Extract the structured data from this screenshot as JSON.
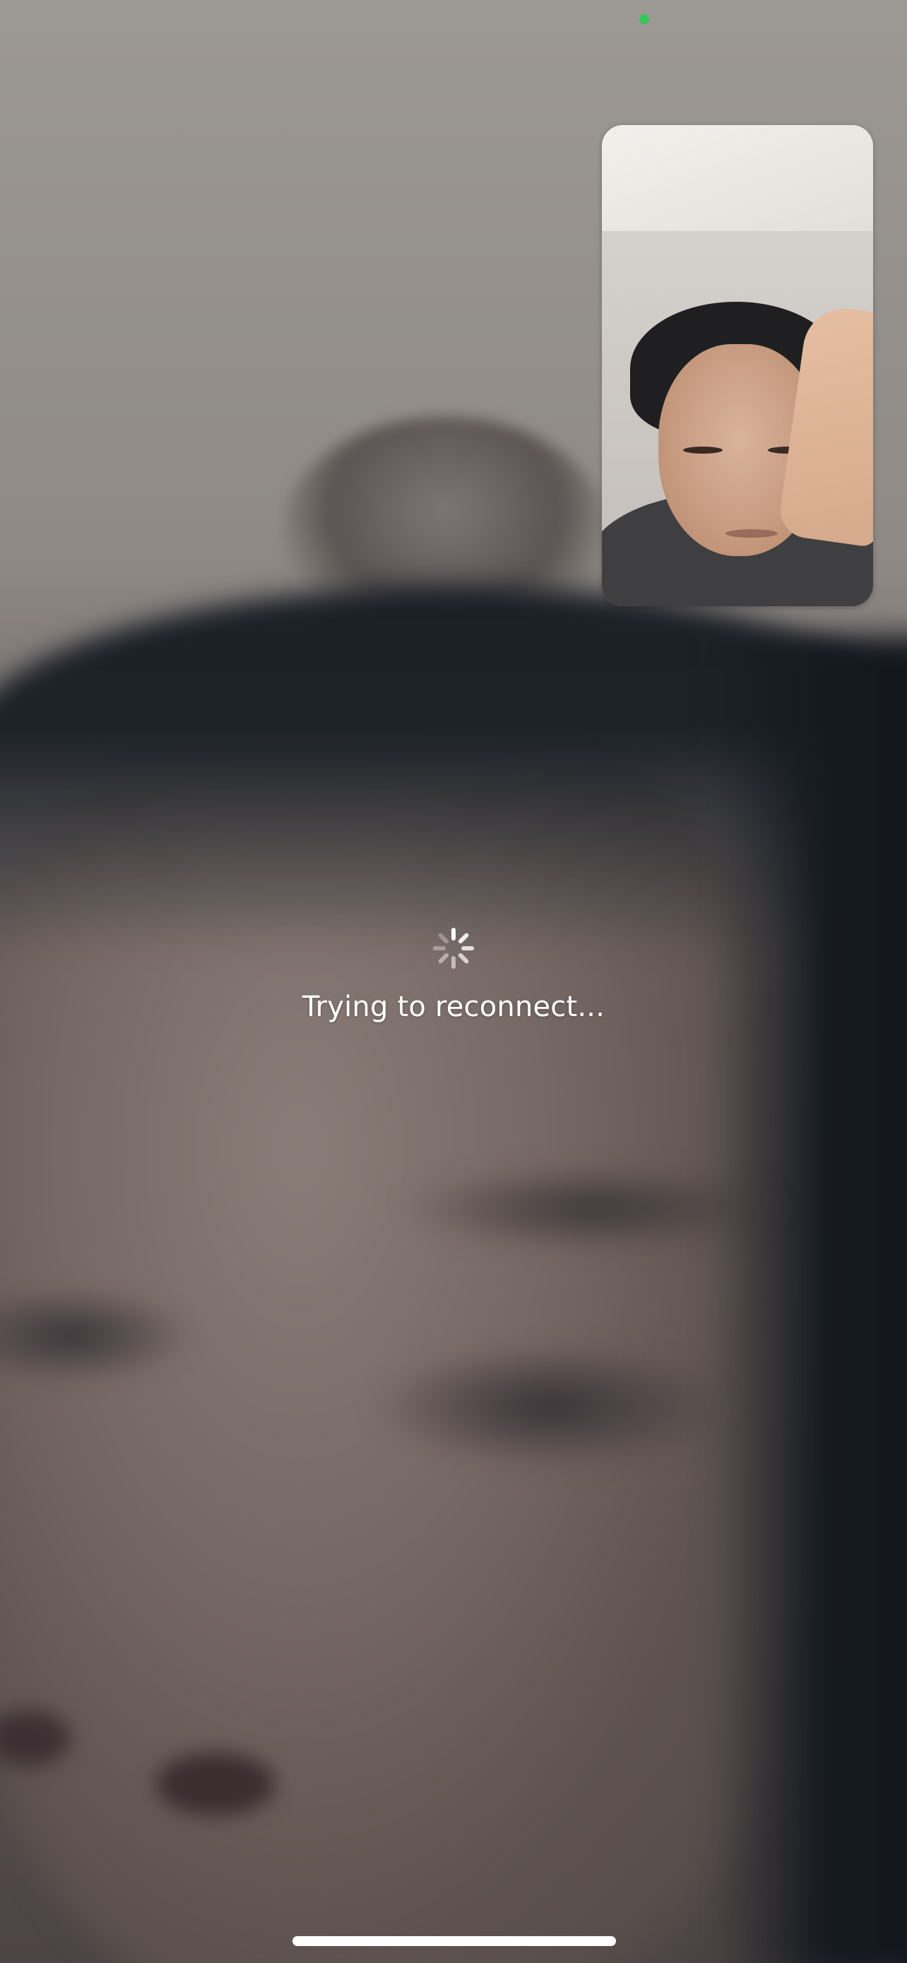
{
  "call": {
    "status_text": "Trying to reconnect...",
    "state": "reconnecting"
  },
  "icons": {
    "spinner": "activity-spinner-icon",
    "camera_indicator": "camera-in-use-dot"
  },
  "colors": {
    "camera_indicator": "#34c759",
    "status_text": "#ffffff",
    "home_indicator": "#ffffff"
  }
}
